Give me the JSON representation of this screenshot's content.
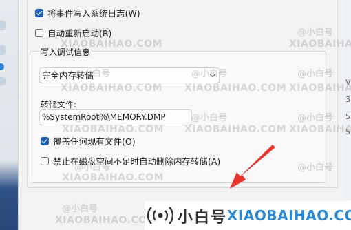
{
  "dialog": {
    "write_event_log": {
      "label": "将事件写入系统日志(W)",
      "checked": true
    },
    "auto_restart": {
      "label": "自动重新启动(R)",
      "checked": false
    },
    "debug_info": {
      "title": "写入调试信息",
      "dump_type": "完全内存转储",
      "dump_file_label": "转储文件:",
      "dump_file_value": "%SystemRoot%\\MEMORY.DMP",
      "overwrite": {
        "label": "覆盖任何现有文件(O)",
        "checked": true
      },
      "disable_auto_delete": {
        "label": "禁止在磁盘空间不足时自动删除内存转储(A)",
        "checked": false
      }
    }
  },
  "behind_right_chars": [
    "V",
    "3",
    "5",
    "5"
  ],
  "watermark": {
    "cn": "@小白号",
    "en": "XIAOBAIHAO.COM"
  },
  "logo": {
    "cn": "小白号",
    "en": "XIAOBAIHAO.COM"
  },
  "colors": {
    "arrow": "#e8342c",
    "accent": "#1f5fb0",
    "logo_blue": "#2a8ad6"
  }
}
